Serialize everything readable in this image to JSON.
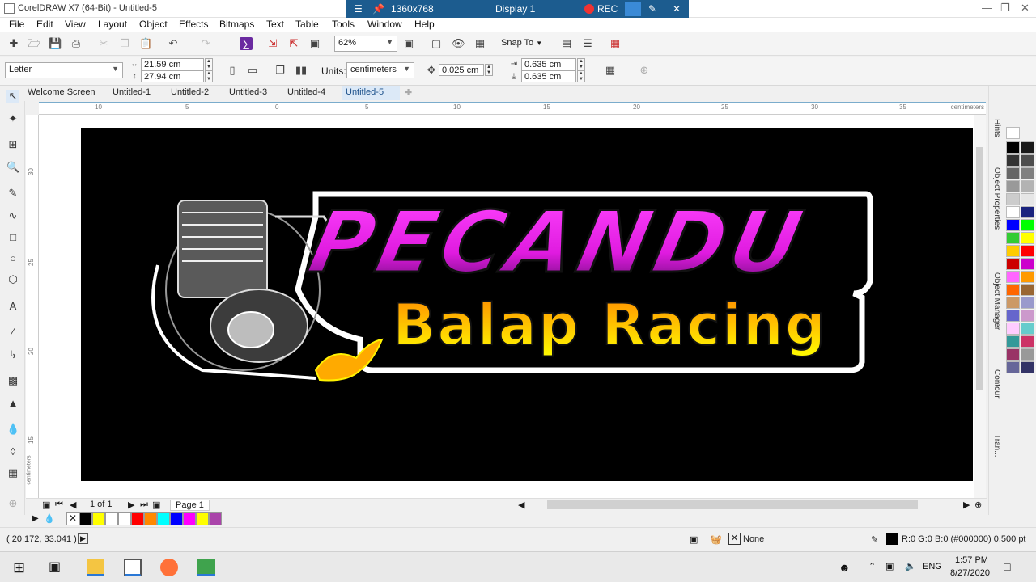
{
  "window": {
    "title": "CorelDRAW X7 (64-Bit) - Untitled-5"
  },
  "remote_bar": {
    "resolution": "1360x768",
    "display": "Display 1",
    "rec_label": "REC"
  },
  "menu": [
    "File",
    "Edit",
    "View",
    "Layout",
    "Object",
    "Effects",
    "Bitmaps",
    "Text",
    "Table",
    "Tools",
    "Window",
    "Help"
  ],
  "toolbar": {
    "zoom": "62%",
    "snap_to": "Snap To"
  },
  "property_bar": {
    "page_size": "Letter",
    "width": "21.59 cm",
    "height": "27.94 cm",
    "units_label": "Units:",
    "units_value": "centimeters",
    "nudge": "0.025 cm",
    "dup_x": "0.635 cm",
    "dup_y": "0.635 cm"
  },
  "tabs": [
    {
      "label": "Welcome Screen",
      "active": false
    },
    {
      "label": "Untitled-1",
      "active": false
    },
    {
      "label": "Untitled-2",
      "active": false
    },
    {
      "label": "Untitled-3",
      "active": false
    },
    {
      "label": "Untitled-4",
      "active": false
    },
    {
      "label": "Untitled-5",
      "active": true
    }
  ],
  "ruler": {
    "h_ticks": [
      "10",
      "5",
      "0",
      "5",
      "10",
      "15",
      "20",
      "25",
      "30",
      "35"
    ],
    "h_unit": "centimeters",
    "v_ticks": [
      "30",
      "25",
      "20",
      "15"
    ],
    "v_unit": "centimeters"
  },
  "artwork": {
    "title_text": "PECANDU",
    "subtitle_text": "Balap Racing",
    "title_color": "#e91ee9",
    "subtitle_color_top": "#ff8800",
    "subtitle_color_bottom": "#ffff00",
    "background": "#000000"
  },
  "page_nav": {
    "counter": "1 of 1",
    "page_tab": "Page 1"
  },
  "doc_palette_colors": [
    "#000000",
    "#ffff00",
    "#ffffff",
    "#ffffff",
    "#ff0000",
    "#ff8800",
    "#00ffff",
    "#0000ff",
    "#ff00ff",
    "#ffff00",
    "#aa44aa"
  ],
  "dockers": [
    "Hints",
    "Object Properties",
    "Object Manager",
    "Contour",
    "Tran..."
  ],
  "palette_colors": [
    "#000000",
    "#1a1a1a",
    "#333333",
    "#4d4d4d",
    "#666666",
    "#808080",
    "#999999",
    "#b3b3b3",
    "#cccccc",
    "#e6e6e6",
    "#ffffff",
    "#1a237e",
    "#0000ff",
    "#00ff00",
    "#33cc33",
    "#ffff00",
    "#ffcc00",
    "#ff0000",
    "#cc0000",
    "#cc00cc",
    "#ff66ff",
    "#ff9900",
    "#ff6600",
    "#996633",
    "#cc9966",
    "#9999cc",
    "#6666cc",
    "#cc99cc",
    "#ffccff",
    "#66cccc",
    "#339999",
    "#cc3366",
    "#993366",
    "#999999",
    "#666699",
    "#333366"
  ],
  "status": {
    "coords": "( 20.172, 33.041 )",
    "fill_label": "None",
    "outline_info": "R:0 G:0 B:0 (#000000)  0.500 pt"
  },
  "taskbar": {
    "lang": "ENG",
    "time": "1:57 PM",
    "date": "8/27/2020"
  }
}
